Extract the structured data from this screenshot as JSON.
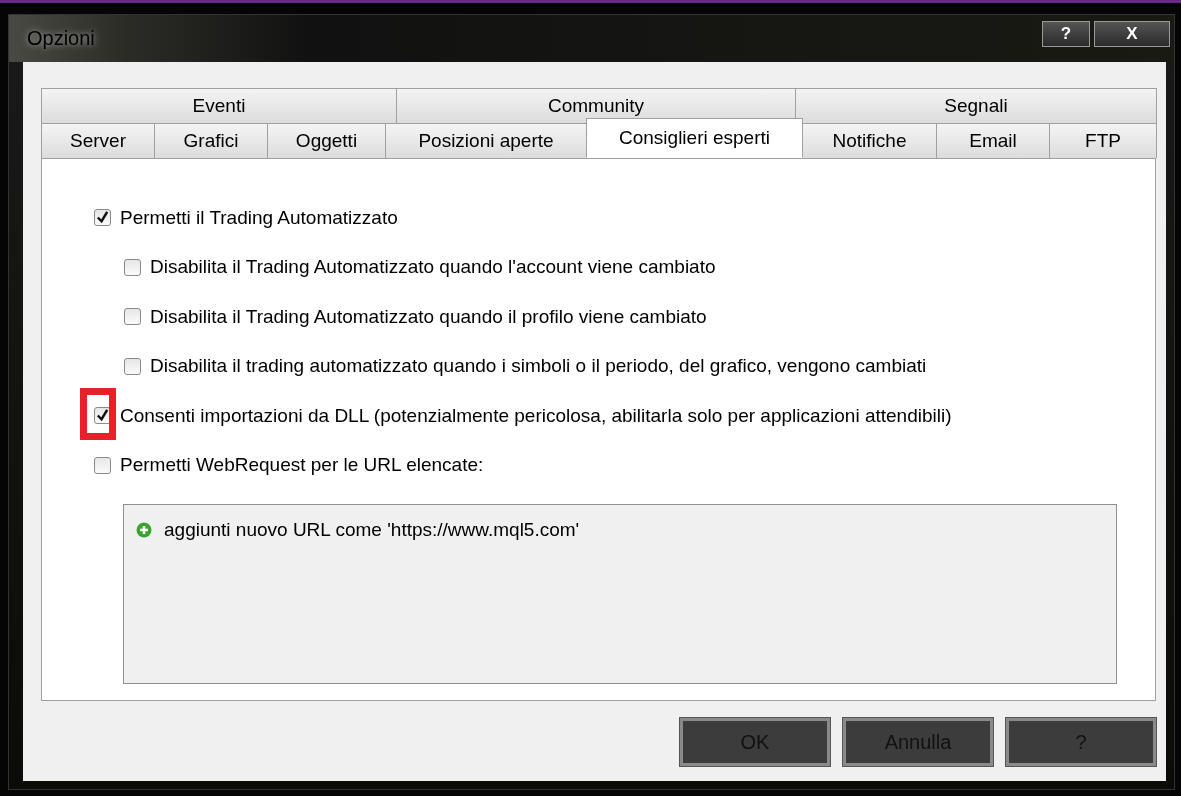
{
  "window": {
    "title": "Opzioni",
    "buttons": [
      "?",
      "X"
    ]
  },
  "tab_rows": [
    [
      {
        "label": "Eventi",
        "selected": false
      },
      {
        "label": "Community",
        "selected": false
      },
      {
        "label": "Segnali",
        "selected": false
      }
    ],
    [
      {
        "label": "Server",
        "selected": false
      },
      {
        "label": "Grafici",
        "selected": false
      },
      {
        "label": "Oggetti",
        "selected": false
      },
      {
        "label": "Posizioni aperte",
        "selected": false
      },
      {
        "label": "Consiglieri esperti",
        "selected": true
      },
      {
        "label": "Notifiche",
        "selected": false
      },
      {
        "label": "Email",
        "selected": false
      },
      {
        "label": "FTP",
        "selected": false
      }
    ]
  ],
  "options": [
    {
      "label": "Permetti il Trading Automatizzato",
      "checked": true,
      "highlighted": false,
      "children": [
        {
          "label": "Disabilita il Trading Automatizzato quando l'account viene cambiato",
          "checked": false,
          "highlighted": false
        },
        {
          "label": "Disabilita il Trading Automatizzato quando il profilo viene cambiato",
          "checked": false,
          "highlighted": false
        },
        {
          "label": "Disabilita il trading automatizzato quando i simboli o il periodo, del grafico, vengono cambiati",
          "checked": false,
          "highlighted": false
        }
      ]
    },
    {
      "label": "Consenti importazioni da DLL (potenzialmente pericolosa, abilitarla solo per applicazioni attendibili)",
      "checked": true,
      "highlighted": true
    },
    {
      "label": "Permetti WebRequest per le URL elencate:",
      "checked": false,
      "highlighted": false
    }
  ],
  "url_list": {
    "items": [
      "aggiunti nuovo URL come 'https://www.mql5.com'"
    ]
  },
  "buttons": [
    "OK",
    "Annulla",
    "?"
  ]
}
